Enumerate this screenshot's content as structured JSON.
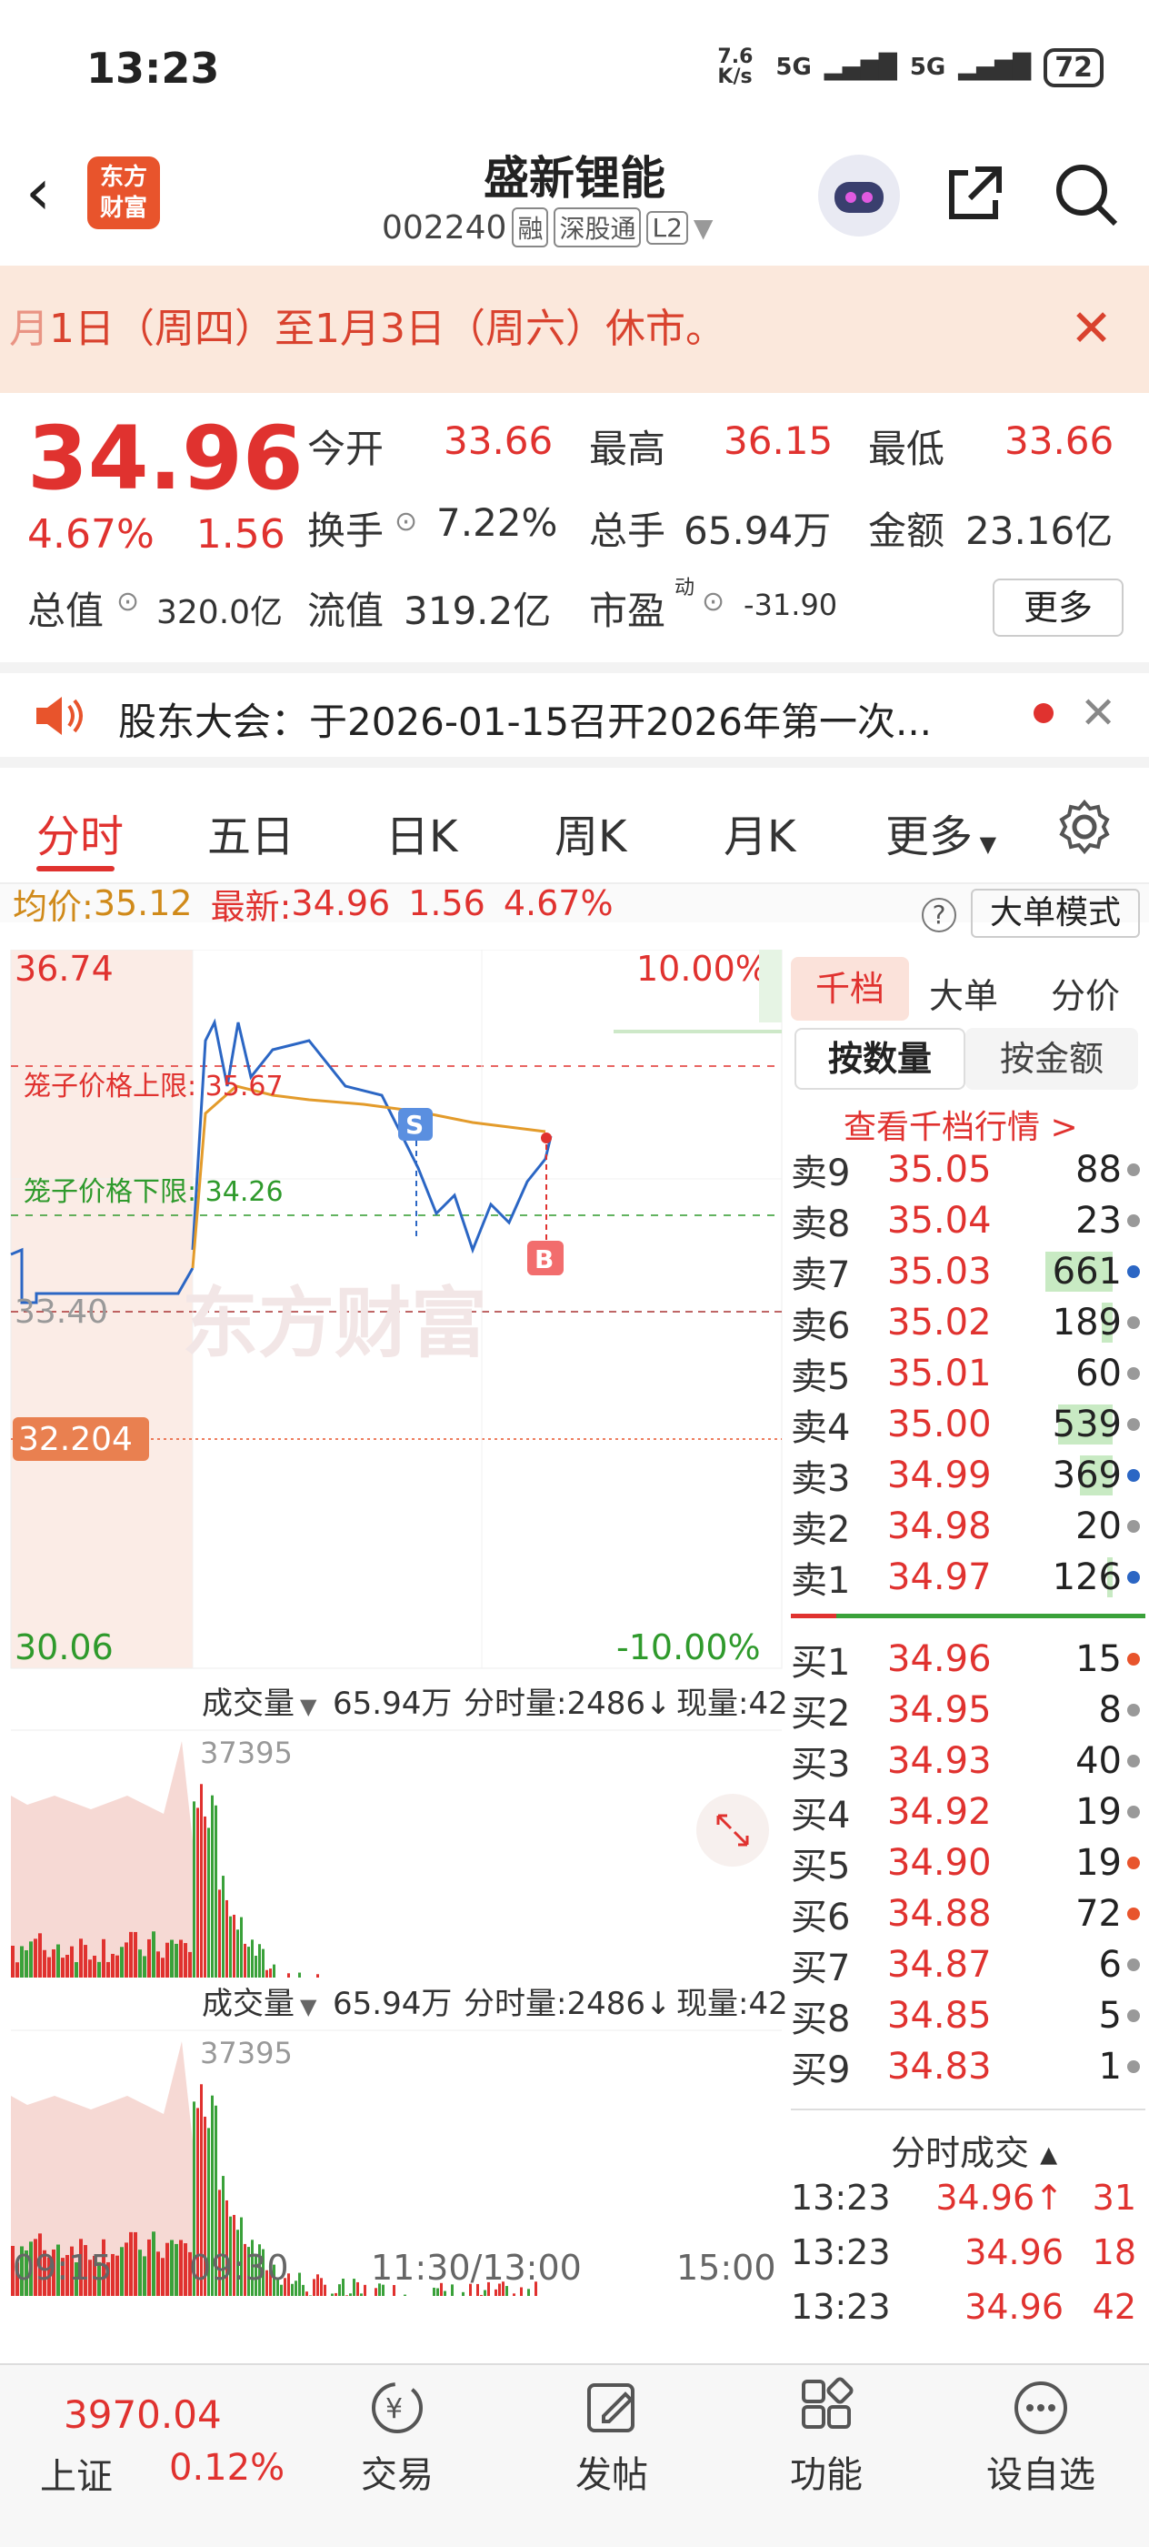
{
  "status": {
    "time": "13:23",
    "net_speed": "7.6 K/s",
    "sig1": "5G",
    "sig2": "5G",
    "battery": "72"
  },
  "header": {
    "title": "盛新锂能",
    "code": "002240",
    "tags": [
      "融",
      "深股通",
      "L2"
    ],
    "logo_text": "东方财富"
  },
  "notice": {
    "text": "1日（周四）至1月3日（周六）休市。",
    "prefix": "月"
  },
  "quote": {
    "price": "34.96",
    "pct": "4.67%",
    "change": "1.56",
    "open_label": "今开",
    "open": "33.66",
    "high_label": "最高",
    "high": "36.15",
    "low_label": "最低",
    "low": "33.66",
    "turnover_label": "换手",
    "turnover": "7.22%",
    "volume_label": "总手",
    "volume": "65.94万",
    "amount_label": "金额",
    "amount": "23.16亿",
    "mcap_label": "总值",
    "mcap": "320.0亿",
    "float_label": "流值",
    "float": "319.2亿",
    "pe_label": "市盈",
    "pe_sup": "动",
    "pe": "-31.90",
    "more": "更多"
  },
  "announce": {
    "text": "股东大会：于2026-01-15召开2026年第一次..."
  },
  "tabs": [
    "分时",
    "五日",
    "日K",
    "周K",
    "月K",
    "更多"
  ],
  "avgline": {
    "avg_label": "均价:",
    "avg": "35.12",
    "latest_label": "最新:",
    "latest": "34.96",
    "chg": "1.56",
    "pct": "4.67%",
    "big_mode": "大单模式"
  },
  "chart": {
    "y_top": "36.74",
    "y_pct_top": "10.00%",
    "y_bottom": "30.06",
    "y_pct_bottom": "-10.00%",
    "prev_close": "33.40",
    "marker": "32.204",
    "cage_upper": "笼子价格上限: 35.67",
    "cage_lower": "笼子价格下限: 34.26",
    "watermark": "东方财富",
    "vol_label": "成交量",
    "vol_total": "65.94万",
    "vol_min": "分时量:2486↓",
    "vol_now": "现量:42",
    "vol_max": "37395",
    "times": [
      "09:15",
      "09:30",
      "11:30/13:00",
      "15:00"
    ]
  },
  "orderbook": {
    "tabs": [
      "千档",
      "大单",
      "分价"
    ],
    "modes": [
      "按数量",
      "按金额"
    ],
    "link": "查看千档行情 >",
    "asks": [
      {
        "label": "卖9",
        "price": "35.05",
        "vol": "88",
        "dot": "#999",
        "bar": 0
      },
      {
        "label": "卖8",
        "price": "35.04",
        "vol": "23",
        "dot": "#999",
        "bar": 0
      },
      {
        "label": "卖7",
        "price": "35.03",
        "vol": "661",
        "dot": "#2b66c4",
        "bar": 0.62
      },
      {
        "label": "卖6",
        "price": "35.02",
        "vol": "189",
        "dot": "#999",
        "bar": 0.1
      },
      {
        "label": "卖5",
        "price": "35.01",
        "vol": "60",
        "dot": "#999",
        "bar": 0
      },
      {
        "label": "卖4",
        "price": "35.00",
        "vol": "539",
        "dot": "#999",
        "bar": 0.5
      },
      {
        "label": "卖3",
        "price": "34.99",
        "vol": "369",
        "dot": "#2b66c4",
        "bar": 0.3
      },
      {
        "label": "卖2",
        "price": "34.98",
        "vol": "20",
        "dot": "#999",
        "bar": 0
      },
      {
        "label": "卖1",
        "price": "34.97",
        "vol": "126",
        "dot": "#2b66c4",
        "bar": 0.05
      }
    ],
    "bids": [
      {
        "label": "买1",
        "price": "34.96",
        "vol": "15",
        "dot": "#e8542c"
      },
      {
        "label": "买2",
        "price": "34.95",
        "vol": "8",
        "dot": "#999"
      },
      {
        "label": "买3",
        "price": "34.93",
        "vol": "40",
        "dot": "#999"
      },
      {
        "label": "买4",
        "price": "34.92",
        "vol": "19",
        "dot": "#999"
      },
      {
        "label": "买5",
        "price": "34.90",
        "vol": "19",
        "dot": "#e8542c"
      },
      {
        "label": "买6",
        "price": "34.88",
        "vol": "72",
        "dot": "#e8542c"
      },
      {
        "label": "买7",
        "price": "34.87",
        "vol": "6",
        "dot": "#999"
      },
      {
        "label": "买8",
        "price": "34.85",
        "vol": "5",
        "dot": "#999"
      },
      {
        "label": "买9",
        "price": "34.83",
        "vol": "1",
        "dot": "#999"
      }
    ],
    "ticks_title": "分时成交 ▴",
    "ticks": [
      {
        "t": "13:23",
        "p": "34.96↑",
        "v": "31"
      },
      {
        "t": "13:23",
        "p": "34.96",
        "v": "18"
      },
      {
        "t": "13:23",
        "p": "34.96",
        "v": "42"
      }
    ]
  },
  "bottom": {
    "index_value": "3970.04",
    "index_name": "上证",
    "index_pct": "0.12%",
    "items": [
      "交易",
      "发帖",
      "功能",
      "设自选"
    ]
  }
}
